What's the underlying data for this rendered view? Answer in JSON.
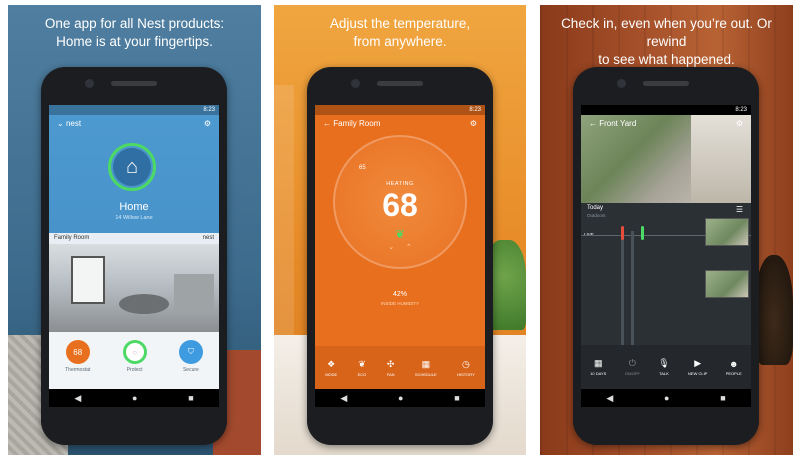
{
  "panels": [
    {
      "caption_line1": "One app for all Nest products:",
      "caption_line2": "Home is at your fingertips.",
      "screen": {
        "time": "8:23",
        "app_logo": "nest",
        "home_title": "Home",
        "home_subtitle": "14 Willow Lane",
        "camera_room": "Family Room",
        "camera_brand": "nest",
        "devices": [
          {
            "label": "Thermostat",
            "value": "68"
          },
          {
            "label": "Protect",
            "value": ""
          },
          {
            "label": "Secure",
            "value": ""
          }
        ]
      }
    },
    {
      "caption_line1": "Adjust the temperature,",
      "caption_line2": "from anywhere.",
      "screen": {
        "time": "8:23",
        "title": "Family Room",
        "mode": "HEATING",
        "target_temp": "68",
        "current_temp": "65",
        "humidity": "42%",
        "humidity_label": "INSIDE HUMIDITY",
        "toolbar": [
          "MODE",
          "ECO",
          "FAN",
          "SCHEDULE",
          "HISTORY"
        ]
      }
    },
    {
      "caption_line1": "Check in, even when you’re out. Or rewind",
      "caption_line2": "to see what happened.",
      "screen": {
        "time": "8:23",
        "title": "Front Yard",
        "today": "Today",
        "today_sub": "Outdoors",
        "live_label": "LIVE",
        "toolbar": [
          "10 DAYS",
          "ON/OFF",
          "TALK",
          "NEW CLIP",
          "PEOPLE"
        ]
      }
    }
  ],
  "colors": {
    "nest_blue": "#3f89c2",
    "heating_orange": "#e86f1d",
    "leaf_green": "#4cd964"
  }
}
